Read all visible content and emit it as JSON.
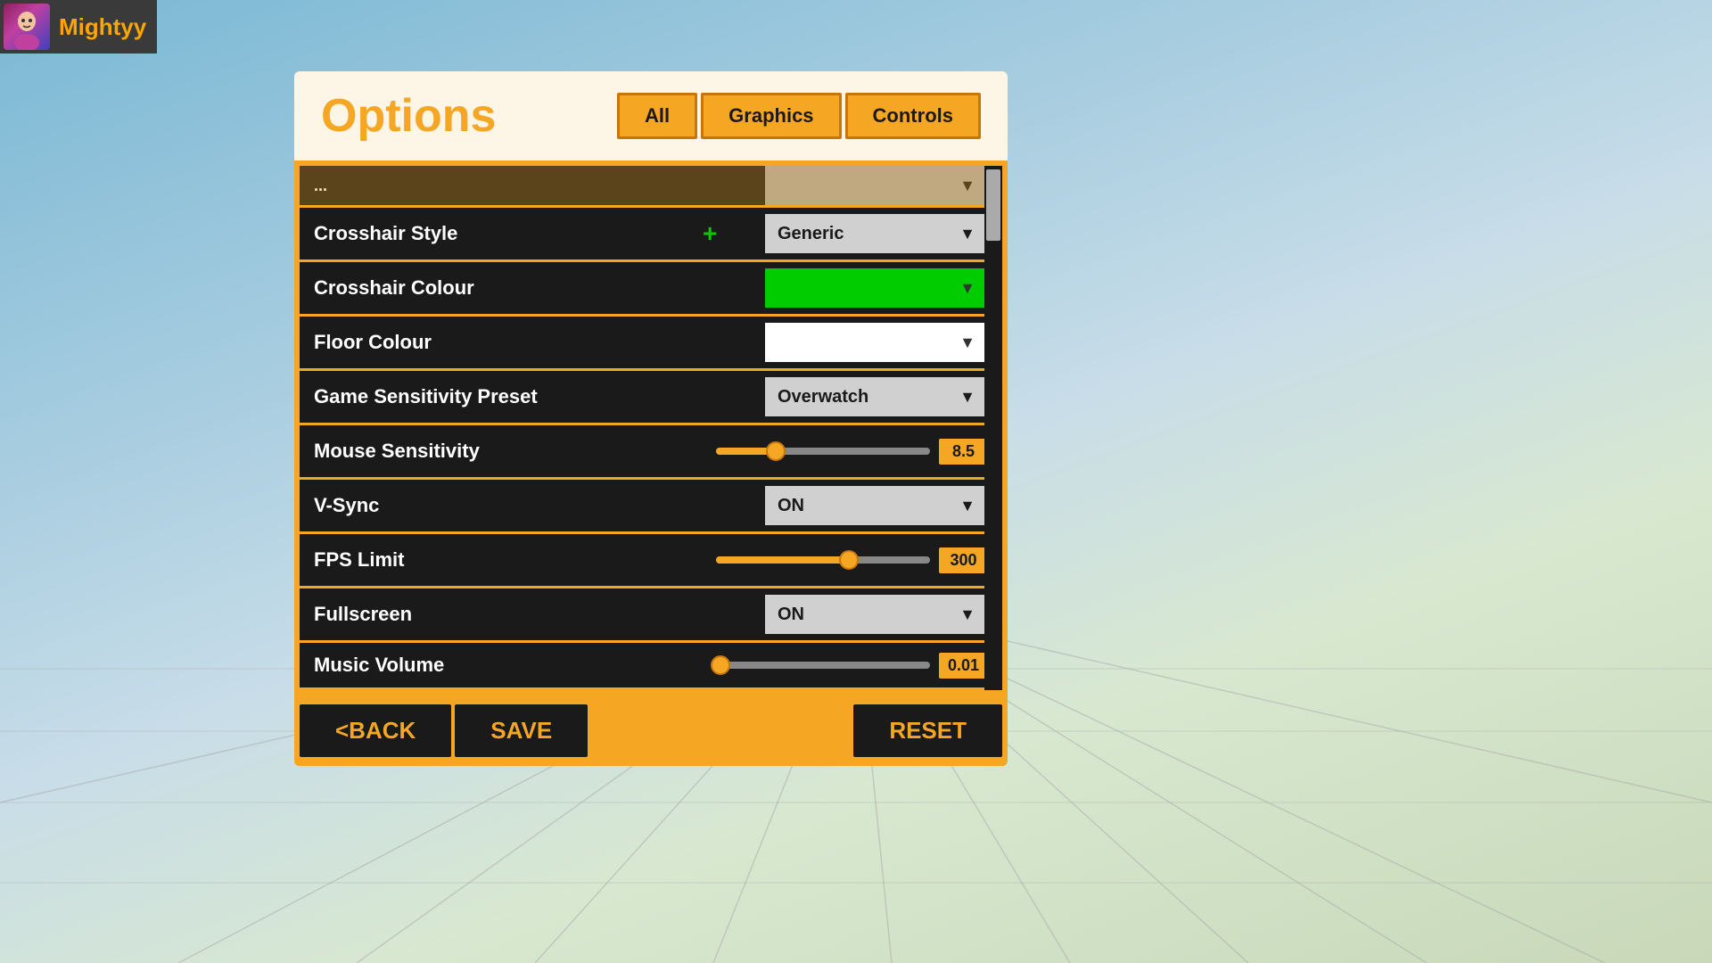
{
  "user": {
    "name": "Mightyy"
  },
  "dialog": {
    "title": "Options",
    "tabs": [
      {
        "id": "all",
        "label": "All",
        "active": true
      },
      {
        "id": "graphics",
        "label": "Graphics",
        "active": false
      },
      {
        "id": "controls",
        "label": "Controls",
        "active": false
      }
    ],
    "settings": [
      {
        "id": "crosshair-style",
        "label": "Crosshair Style",
        "type": "dropdown",
        "value": "Generic",
        "hasIcon": true
      },
      {
        "id": "crosshair-colour",
        "label": "Crosshair Colour",
        "type": "dropdown-color",
        "colorClass": "green-bg",
        "value": ""
      },
      {
        "id": "floor-colour",
        "label": "Floor Colour",
        "type": "dropdown-color",
        "colorClass": "white-bg",
        "value": ""
      },
      {
        "id": "game-sensitivity-preset",
        "label": "Game Sensitivity Preset",
        "type": "dropdown",
        "value": "Overwatch"
      },
      {
        "id": "mouse-sensitivity",
        "label": "Mouse Sensitivity",
        "type": "slider",
        "value": "8.5",
        "fillPercent": 28
      },
      {
        "id": "vsync",
        "label": "V-Sync",
        "type": "dropdown",
        "value": "ON"
      },
      {
        "id": "fps-limit",
        "label": "FPS Limit",
        "type": "slider",
        "value": "300",
        "fillPercent": 62
      },
      {
        "id": "fullscreen",
        "label": "Fullscreen",
        "type": "dropdown",
        "value": "ON"
      },
      {
        "id": "music-volume",
        "label": "Music Volume",
        "type": "slider",
        "value": "0.01",
        "fillPercent": 2
      }
    ],
    "footer": {
      "back_label": "<BACK",
      "save_label": "SAVE",
      "reset_label": "RESET"
    }
  }
}
